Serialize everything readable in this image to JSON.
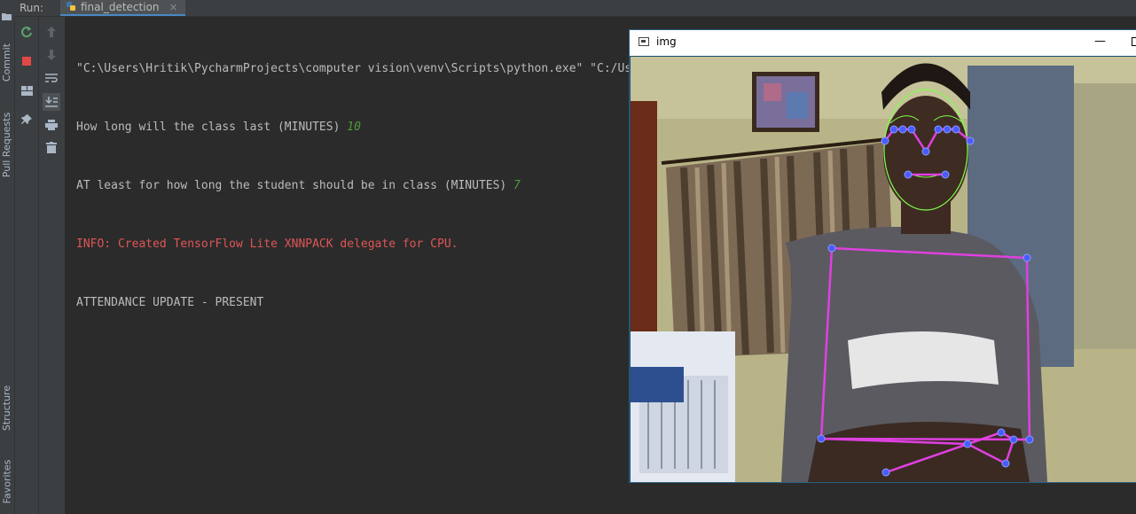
{
  "sidebar": {
    "items": [
      {
        "label": "Commit"
      },
      {
        "label": "Pull Requests"
      },
      {
        "label": "Structure"
      },
      {
        "label": "Favorites"
      }
    ]
  },
  "runbar": {
    "run_label": "Run:",
    "tab_label": "final_detection",
    "close_glyph": "×"
  },
  "console": {
    "line1": "\"C:\\Users\\Hritik\\PycharmProjects\\computer vision\\venv\\Scripts\\python.exe\" \"C:/Users/Hritik/PycharmProjects/computer vision/venv/Smart_AI_student_acti",
    "line2_text": "How long will the class last (MINUTES) ",
    "line2_input": "10",
    "line3_text": "AT least for how long the student should be in class (MINUTES) ",
    "line3_input": "7",
    "line4": "INFO: Created TensorFlow Lite XNNPACK delegate for CPU.",
    "line5": "ATTENDANCE UPDATE - PRESENT"
  },
  "imgwin": {
    "title": "img",
    "minimize_glyph": "—"
  },
  "colors": {
    "error_text": "#e05555",
    "input_text": "#4e9a3a",
    "landmark_blue": "#4a5cff",
    "pose_magenta": "#e040e0",
    "face_mesh_green": "#7dff4a"
  }
}
